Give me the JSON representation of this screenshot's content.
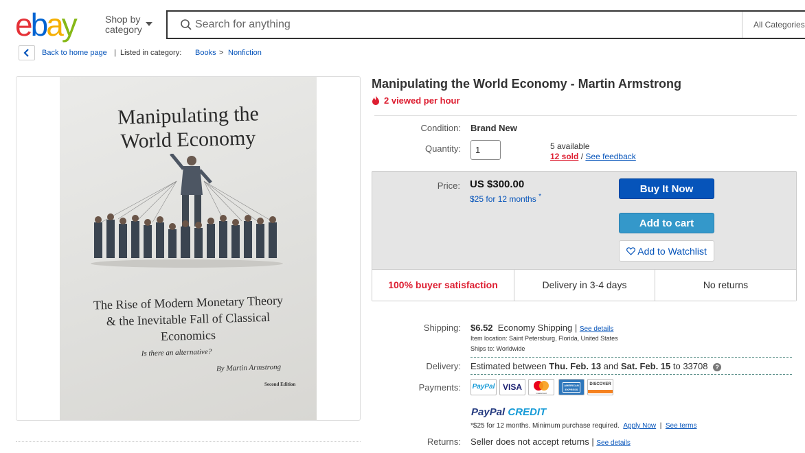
{
  "header": {
    "logo": "ebay",
    "shop_by_line1": "Shop by",
    "shop_by_line2": "category",
    "search_placeholder": "Search for anything",
    "category_select": "All Categories"
  },
  "breadcrumb": {
    "back": "Back to home page",
    "listed_in": "Listed in category:",
    "items": [
      "Books",
      "Nonfiction"
    ],
    "separator": ">"
  },
  "book_cover": {
    "title_line1": "Manipulating the",
    "title_line2": "World Economy",
    "subtitle_line1": "The Rise of Modern Monetary Theory",
    "subtitle_line2": "& the Inevitable Fall of Classical",
    "subtitle_line3": "Economics",
    "question": "Is there an alternative?",
    "author": "By Martin Armstrong",
    "edition": "Second Edition"
  },
  "listing": {
    "title": "Manipulating the World Economy - Martin Armstrong",
    "views": "2 viewed per hour",
    "condition_label": "Condition:",
    "condition": "Brand New",
    "quantity_label": "Quantity:",
    "quantity": "1",
    "available": "5 available",
    "sold": "12 sold",
    "slash": "/",
    "feedback": "See feedback",
    "price_label": "Price:",
    "price": "US $300.00",
    "monthly": "$25 for 12 months",
    "monthly_mark": "*",
    "buy_now": "Buy It Now",
    "add_to_cart": "Add to cart",
    "watchlist": "Add to Watchlist",
    "trust": [
      "100% buyer satisfaction",
      "Delivery in 3-4 days",
      "No returns"
    ]
  },
  "shipping": {
    "label": "Shipping:",
    "cost": "$6.52",
    "method": "Economy Shipping",
    "pipe": "|",
    "details": "See details",
    "location": "Item location:  Saint Petersburg, Florida, United States",
    "ships_to": "Ships to:  Worldwide",
    "delivery_label": "Delivery:",
    "delivery_pre": "Estimated between",
    "delivery_d1": "Thu. Feb. 13",
    "delivery_and": "and",
    "delivery_d2": "Sat. Feb. 15",
    "delivery_to": "to 33708",
    "payments_label": "Payments:",
    "payment_methods": [
      "PayPal",
      "VISA",
      "mastercard",
      "AMERICAN EXPRESS",
      "DISCOVER"
    ],
    "ppcredit_a": "PayPal",
    "ppcredit_b": "CREDIT",
    "credit_note": "*$25 for 12 months. Minimum purchase required.",
    "apply_now": "Apply Now",
    "see_terms": "See terms",
    "returns_label": "Returns:",
    "returns": "Seller does not accept returns",
    "returns_details": "See details"
  },
  "colors": {
    "logo_e": "#e53238",
    "logo_b": "#0064d2",
    "logo_a": "#f5af02",
    "logo_y": "#86b817",
    "buy_now": "#0654ba",
    "add_to_cart": "#3498ca",
    "alert_red": "#dd1e31",
    "link_blue": "#0654ba"
  }
}
